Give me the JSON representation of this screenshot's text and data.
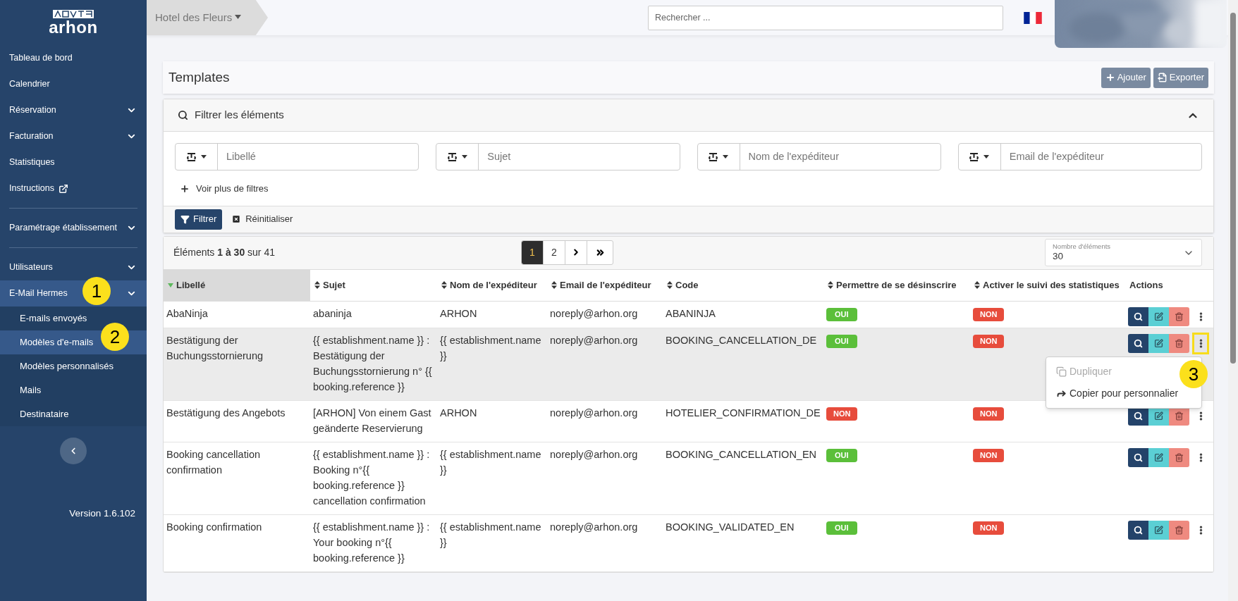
{
  "sidebar": {
    "logo_text": "arhon",
    "items": [
      {
        "kind": "link",
        "label": "Tableau de bord"
      },
      {
        "kind": "link",
        "label": "Calendrier"
      },
      {
        "kind": "group",
        "label": "Réservation",
        "selected": false
      },
      {
        "kind": "group",
        "label": "Facturation",
        "selected": false
      },
      {
        "kind": "link",
        "label": "Statistiques"
      },
      {
        "kind": "external",
        "label": "Instructions"
      },
      {
        "kind": "divider"
      },
      {
        "kind": "group",
        "label": "Paramétrage établissement",
        "selected": false
      },
      {
        "kind": "divider"
      },
      {
        "kind": "group",
        "label": "Utilisateurs",
        "selected": false
      },
      {
        "kind": "group",
        "label": "E-Mail Hermes",
        "selected": true,
        "children": [
          {
            "label": "E-mails envoyés",
            "selected": false
          },
          {
            "label": "Modèles d'e-mails",
            "selected": true
          },
          {
            "label": "Modèles personnalisés",
            "selected": false
          },
          {
            "label": "Mails",
            "selected": false
          },
          {
            "label": "Destinataire",
            "selected": false
          }
        ]
      }
    ],
    "version": "Version 1.6.102"
  },
  "header": {
    "establishment": "Hotel des Fleurs",
    "search": {
      "placeholder": "Rechercher ..."
    }
  },
  "page": {
    "title": "Templates",
    "buttons": [
      {
        "kind": "add",
        "label": "Ajouter"
      },
      {
        "kind": "export",
        "label": "Exporter"
      }
    ]
  },
  "filters": {
    "title": "Filtrer les éléments",
    "expanded": true,
    "fields": [
      {
        "placeholder": "Libellé"
      },
      {
        "placeholder": "Sujet"
      },
      {
        "placeholder": "Nom de l'expéditeur"
      },
      {
        "placeholder": "Email de l'expéditeur"
      }
    ],
    "more": "Voir plus de filtres",
    "apply": "Filtrer",
    "reset": "Réinitialiser"
  },
  "table": {
    "summary": "Éléments **1 à 30** sur 41",
    "pages": [
      {
        "label": "1",
        "selected": true
      },
      {
        "label": "2",
        "selected": false
      }
    ],
    "page_size": {
      "label": "Nombre d'éléments",
      "value": "30"
    },
    "columns": [
      {
        "label": "Libellé",
        "sorted": true
      },
      {
        "label": "Sujet",
        "sorted": false
      },
      {
        "label": "Nom de l'expéditeur",
        "sorted": false
      },
      {
        "label": "Email de l'expéditeur",
        "sorted": false
      },
      {
        "label": "Code",
        "sorted": false
      },
      {
        "label": "Permettre de se désinscrire",
        "sorted": false
      },
      {
        "label": "Activer le suivi des statistiques",
        "sorted": false
      },
      {
        "label": "Actions",
        "sortable": false
      }
    ],
    "rows": [
      {
        "selected": false,
        "highlighted": false,
        "cells": [
          "AbaNinja",
          "abaninja",
          "ARHON",
          "noreply@arhon.org",
          "ABANINJA"
        ],
        "unsubscribe": {
          "label": "OUI",
          "on": true
        },
        "tracking": {
          "label": "NON",
          "on": false
        }
      },
      {
        "selected": true,
        "highlighted": true,
        "menu": [
          {
            "kind": "duplicate",
            "label": "Dupliquer",
            "disabled": true
          },
          {
            "kind": "copy",
            "label": "Copier pour personnalier",
            "disabled": false
          }
        ],
        "cells": [
          "Bestätigung der Buchungsstornierung",
          "{{ establishment.name }} : Bestätigung der Buchungsstornierung n° {{ booking.reference }}",
          "{{ establishment.name }}",
          "noreply@arhon.org",
          "BOOKING_CANCELLATION_DE"
        ],
        "unsubscribe": {
          "label": "OUI",
          "on": true
        },
        "tracking": {
          "label": "NON",
          "on": false
        }
      },
      {
        "selected": false,
        "highlighted": false,
        "cells": [
          "Bestätigung des Angebots",
          "[ARHON] Von einem Gast geänderte Reservierung",
          "ARHON",
          "noreply@arhon.org",
          "HOTELIER_CONFIRMATION_DE"
        ],
        "unsubscribe": {
          "label": "NON",
          "on": false
        },
        "tracking": {
          "label": "NON",
          "on": false
        }
      },
      {
        "selected": false,
        "highlighted": false,
        "cells": [
          "Booking cancellation confirmation",
          "{{ establishment.name }} : Booking n°{{ booking.reference }} cancellation confirmation",
          "{{ establishment.name }}",
          "noreply@arhon.org",
          "BOOKING_CANCELLATION_EN"
        ],
        "unsubscribe": {
          "label": "OUI",
          "on": true
        },
        "tracking": {
          "label": "NON",
          "on": false
        }
      },
      {
        "selected": false,
        "highlighted": false,
        "cells": [
          "Booking confirmation",
          "{{ establishment.name }} : Your booking n°{{ booking.reference }}",
          "{{ establishment.name }}",
          "noreply@arhon.org",
          "BOOKING_VALIDATED_EN"
        ],
        "unsubscribe": {
          "label": "OUI",
          "on": true
        },
        "tracking": {
          "label": "NON",
          "on": false
        }
      }
    ]
  },
  "callouts": [
    {
      "label": "1"
    },
    {
      "label": "2"
    },
    {
      "label": "3"
    }
  ]
}
